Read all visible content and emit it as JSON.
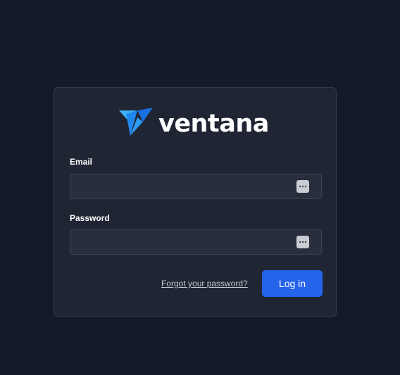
{
  "brand": {
    "name": "ventana",
    "icon": "ventana-logo-icon",
    "colors": {
      "mark_light": "#2fa8f5",
      "mark_dark": "#1a6fe0"
    }
  },
  "form": {
    "email_label": "Email",
    "email_value": "",
    "password_label": "Password",
    "password_value": "",
    "password_manager_icon": "password-manager-icon",
    "forgot_link": "Forgot your password?",
    "submit_label": "Log in"
  },
  "colors": {
    "background": "#141a28",
    "card": "#1f2533",
    "input": "#282e3b",
    "primary": "#2563eb"
  }
}
